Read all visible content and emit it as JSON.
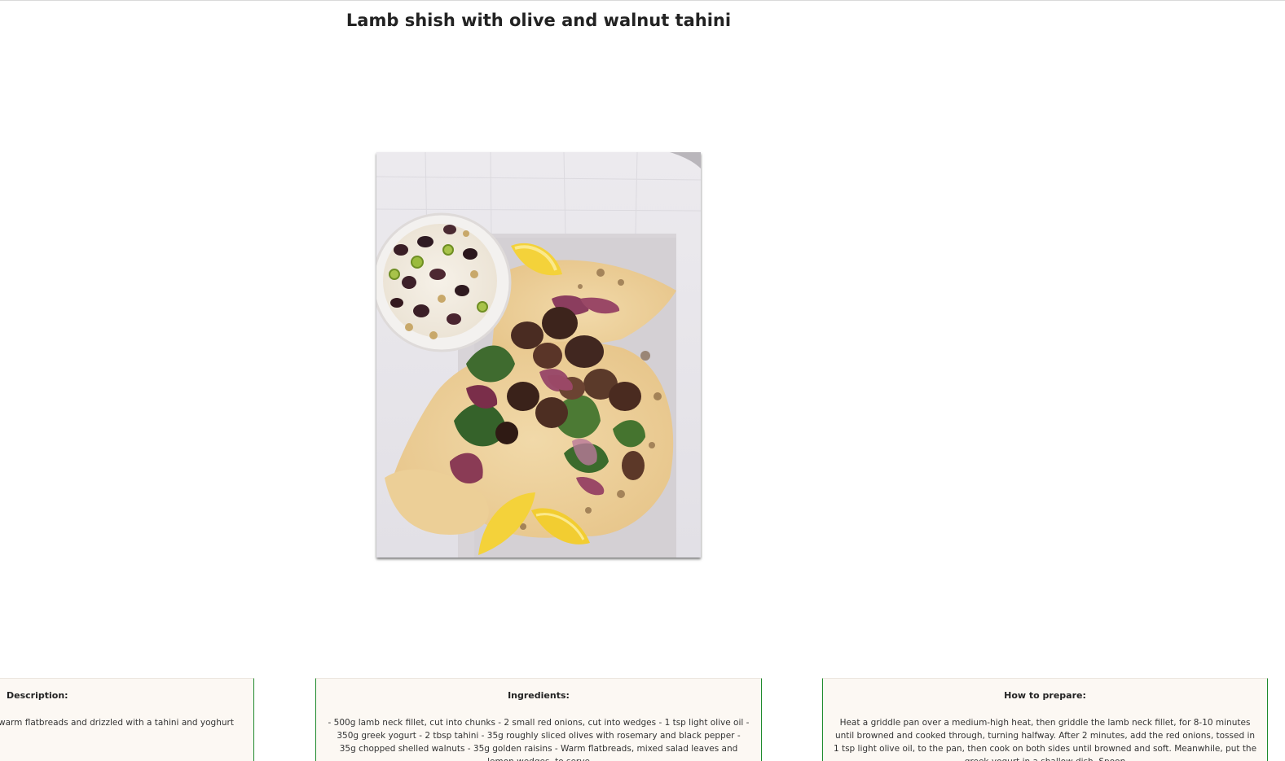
{
  "recipe": {
    "title": "Lamb shish with olive and walnut tahini",
    "image_alt": "Lamb shish with olive and walnut tahini"
  },
  "sections": {
    "description": {
      "heading": "Description:",
      "text": "warm flatbreads and drizzled with a tahini and yoghurt"
    },
    "ingredients": {
      "heading": "Ingredients:",
      "text": "- 500g lamb neck fillet, cut into chunks - 2 small red onions, cut into wedges - 1 tsp light olive oil - 350g greek yogurt - 2 tbsp tahini - 35g roughly sliced olives with rosemary and black pepper - 35g chopped shelled walnuts - 35g golden raisins - Warm flatbreads, mixed salad leaves and lemon wedges, to serve"
    },
    "preparation": {
      "heading": "How to prepare:",
      "text": "Heat a griddle pan over a medium-high heat, then griddle the lamb neck fillet, for 8-10 minutes until browned and cooked through, turning halfway. After 2 minutes, add the red onions, tossed in 1 tsp light olive oil, to the pan, then cook on both sides until browned and soft. Meanwhile, put the greek yogurt in a shallow dish. Spoon"
    }
  },
  "colors": {
    "card_background": "#fcf8f3",
    "card_border": "#1f8a2c"
  }
}
